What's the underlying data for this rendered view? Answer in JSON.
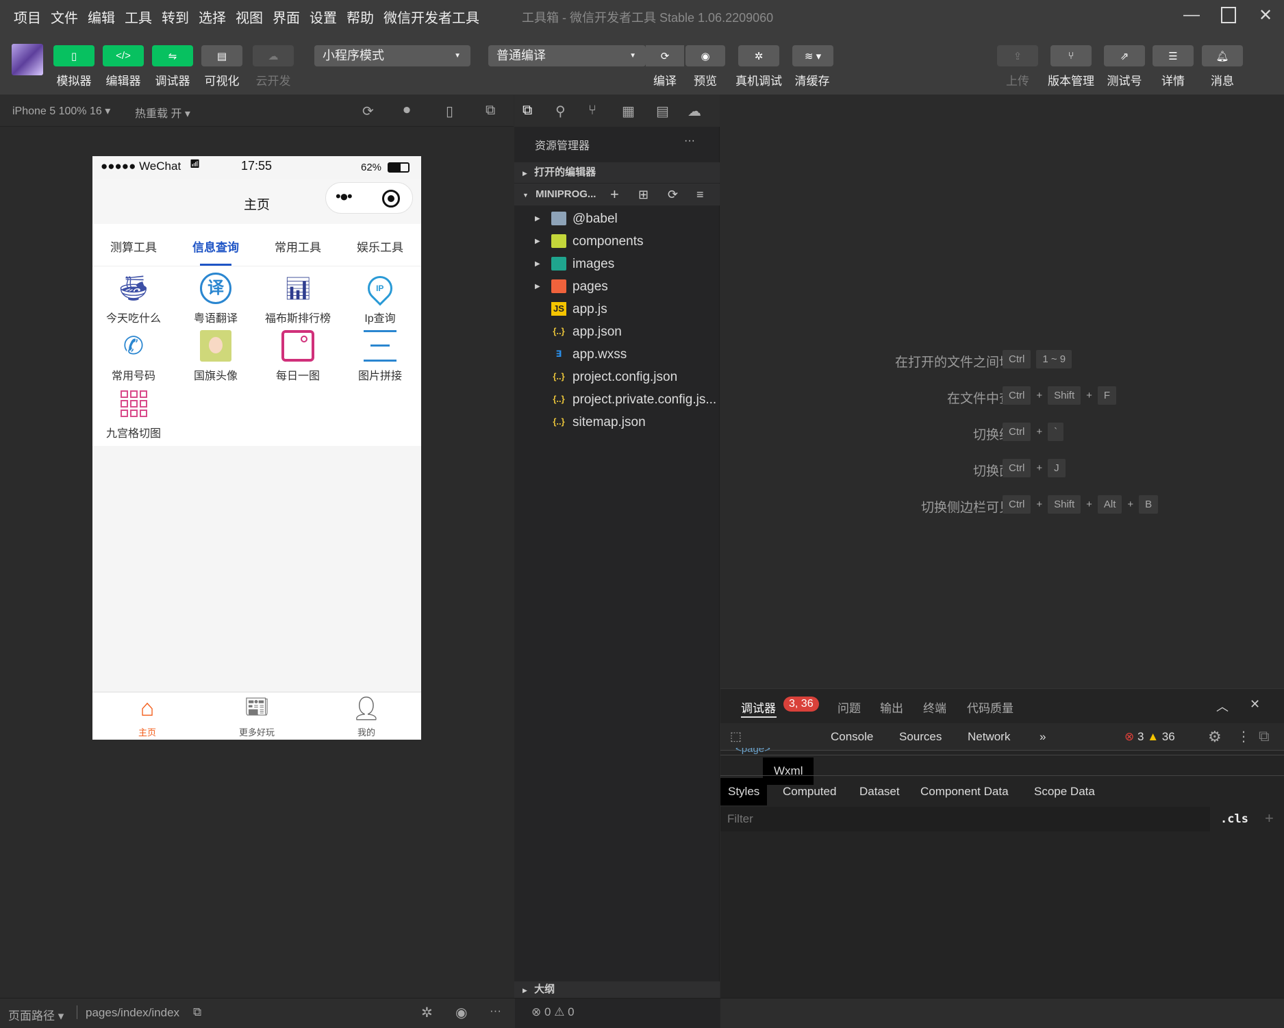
{
  "menubar": {
    "items": [
      "项目",
      "文件",
      "编辑",
      "工具",
      "转到",
      "选择",
      "视图",
      "界面",
      "设置",
      "帮助",
      "微信开发者工具"
    ],
    "window_title": "工具箱 - 微信开发者工具 Stable 1.06.2209060"
  },
  "toolbar": {
    "simulator": "模拟器",
    "editor": "编辑器",
    "debugger": "调试器",
    "visual": "可视化",
    "cloud": "云开发",
    "mode_select": "小程序模式",
    "compile_select": "普通编译",
    "compile": "编译",
    "preview": "预览",
    "remote_debug": "真机调试",
    "clear_cache": "清缓存",
    "upload": "上传",
    "version": "版本管理",
    "test_account": "测试号",
    "details": "详情",
    "messages": "消息",
    "accent": "#07c160"
  },
  "subbar": {
    "device": "iPhone 5 100% 16",
    "hot_reload": "热重载 开"
  },
  "phone": {
    "carrier": "●●●●● WeChat",
    "time": "17:55",
    "battery": "62%",
    "battery_level": 0.62,
    "title": "主页",
    "tabs": [
      "测算工具",
      "信息查询",
      "常用工具",
      "娱乐工具"
    ],
    "active_tab": 1,
    "grid": [
      "今天吃什么",
      "粤语翻译",
      "福布斯排行榜",
      "Ip查询",
      "常用号码",
      "国旗头像",
      "每日一图",
      "图片拼接",
      "九宫格切图"
    ],
    "tabbar": [
      "主页",
      "更多好玩",
      "我的"
    ],
    "tab_active_color": "#f35d1a"
  },
  "explorer": {
    "title": "资源管理器",
    "more": "···",
    "open_editors": "打开的编辑器",
    "project": "MINIPROG...",
    "items": [
      {
        "name": "@babel",
        "type": "folder"
      },
      {
        "name": "components",
        "type": "folder"
      },
      {
        "name": "images",
        "type": "folder"
      },
      {
        "name": "pages",
        "type": "folder"
      },
      {
        "name": "app.js",
        "type": "js"
      },
      {
        "name": "app.json",
        "type": "json"
      },
      {
        "name": "app.wxss",
        "type": "wxss"
      },
      {
        "name": "project.config.json",
        "type": "json"
      },
      {
        "name": "project.private.config.js...",
        "type": "json"
      },
      {
        "name": "sitemap.json",
        "type": "json"
      }
    ],
    "outline": "大纲",
    "errors": "0",
    "warnings": "0"
  },
  "shortcuts": [
    {
      "desc": "在打开的文件之间切换",
      "keys": [
        "Ctrl",
        "1 ~ 9"
      ],
      "sep": ""
    },
    {
      "desc": "在文件中查找",
      "keys": [
        "Ctrl",
        "Shift",
        "F"
      ],
      "sep": "+"
    },
    {
      "desc": "切换终端",
      "keys": [
        "Ctrl",
        "`"
      ],
      "sep": "+"
    },
    {
      "desc": "切换面板",
      "keys": [
        "Ctrl",
        "J"
      ],
      "sep": "+"
    },
    {
      "desc": "切换侧边栏可见性",
      "keys": [
        "Ctrl",
        "Shift",
        "Alt",
        "B"
      ],
      "sep": "+"
    }
  ],
  "debug": {
    "tabs": [
      "调试器",
      "问题",
      "输出",
      "终端",
      "代码质量"
    ],
    "badge": "3, 36",
    "devtabs": [
      "Wxml",
      "Console",
      "Sources",
      "Network"
    ],
    "more": "»",
    "errors": "3",
    "warnings": "36",
    "wxml_snippet": "<page>",
    "subtabs": [
      "Styles",
      "Computed",
      "Dataset",
      "Component Data",
      "Scope Data"
    ],
    "filter_placeholder": "Filter",
    "cls": ".cls",
    "plus": "+"
  },
  "status": {
    "path_label": "页面路径",
    "path": "pages/index/index",
    "more": "···"
  }
}
